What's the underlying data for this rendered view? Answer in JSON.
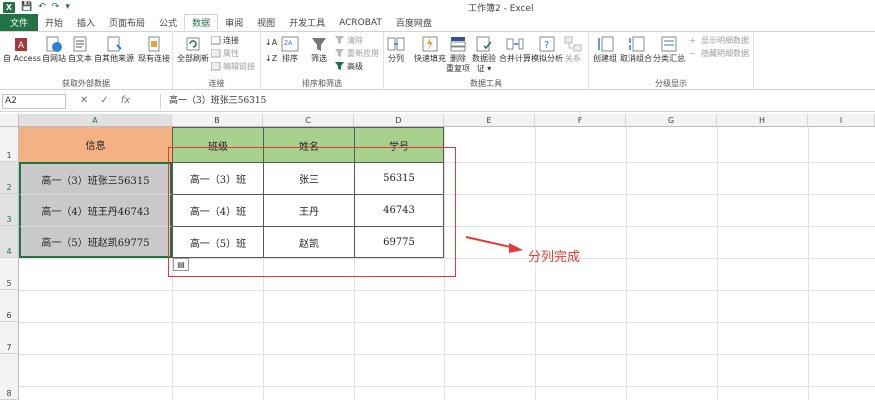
{
  "title_bar": {
    "app_letter": "X",
    "window_title": "工作簿2 - Excel"
  },
  "tabs": [
    "文件",
    "开始",
    "插入",
    "页面布局",
    "公式",
    "数据",
    "审阅",
    "视图",
    "开发工具",
    "ACROBAT",
    "百度网盘"
  ],
  "active_tab_index": 5,
  "ribbon": {
    "groups": {
      "external": "获取外部数据",
      "connections": "连接",
      "sort_filter": "排序和筛选",
      "data_tools": "数据工具",
      "outline": "分级显示"
    },
    "buttons": {
      "from_access": "自 Access",
      "from_web": "自网站",
      "from_text": "自文本",
      "from_other": "自其他来源",
      "existing_conn": "现有连接",
      "refresh_all": "全部刷新",
      "connections": "连接",
      "properties": "属性",
      "edit_links": "编辑链接",
      "sort_az": "↓A",
      "sort_za": "↓Z",
      "sort": "排序",
      "filter": "筛选",
      "clear": "清除",
      "reapply": "重新应用",
      "advanced": "高级",
      "text_to_columns": "分列",
      "flash_fill": "快速填充",
      "remove_duplicates": "删除\n重复项",
      "data_validation": "数据验\n证 ▾",
      "consolidate": "合并计算",
      "what_if": "模拟分析",
      "relationships": "关系",
      "group": "创建组",
      "ungroup": "取消组合",
      "subtotal": "分类汇总",
      "show_detail": "显示明细数据",
      "hide_detail": "隐藏明细数据"
    }
  },
  "formula_bar": {
    "name_box": "A2",
    "content": "高一（3）班张三56315",
    "fx": "fx"
  },
  "columns": [
    "A",
    "B",
    "C",
    "D",
    "E",
    "F",
    "G",
    "H",
    "I"
  ],
  "rows": [
    "1",
    "2",
    "3",
    "4",
    "5",
    "6",
    "7",
    "8"
  ],
  "sheet": {
    "headers": {
      "info": "信息",
      "class": "班级",
      "name": "姓名",
      "id": "学号"
    },
    "info": [
      "高一（3）班张三56315",
      "高一（4）班王丹46743",
      "高一（5）班赵凯69775"
    ],
    "split_rows": [
      [
        "高一（3）班",
        "张三",
        "56315"
      ],
      [
        "高一（4）班",
        "王丹",
        "46743"
      ],
      [
        "高一（5）班",
        "赵凯",
        "69775"
      ]
    ]
  },
  "annotation": {
    "text": "分列完成",
    "color": "#e53935"
  },
  "colors": {
    "excel_green": "#217346",
    "header_orange": "#f4b183",
    "header_green": "#a9d18e",
    "selection_gray": "#c9c9c9"
  }
}
